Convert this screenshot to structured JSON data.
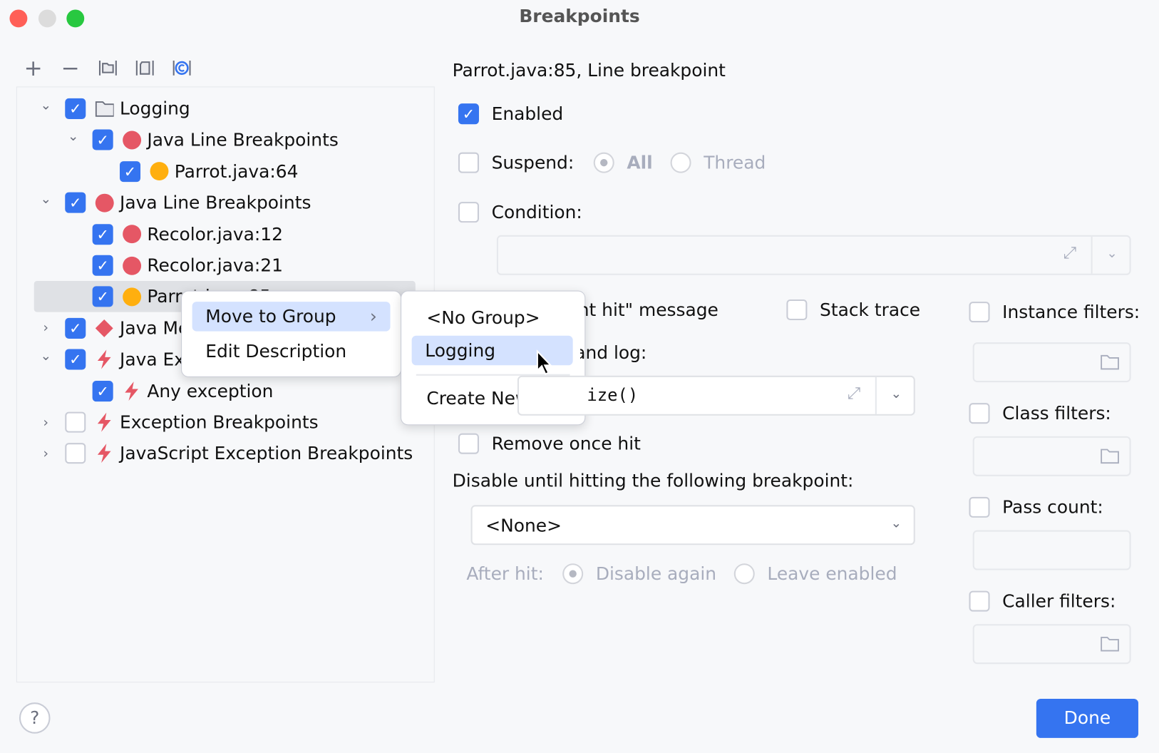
{
  "window": {
    "title": "Breakpoints"
  },
  "colors": {
    "accent": "#3574f0",
    "red_breakpoint": "#e55765",
    "orange_breakpoint": "#ffaf0f",
    "menu_highlight": "#d4e2ff"
  },
  "toolbar": {
    "icons": [
      "plus-icon",
      "minus-icon",
      "folder-group-icon",
      "file-group-icon",
      "class-group-icon"
    ]
  },
  "tree": [
    {
      "label": "Logging",
      "checked": true,
      "expanded": true,
      "icon": "folder-icon"
    },
    {
      "label": "Java Line Breakpoints",
      "checked": true,
      "expanded": true,
      "icon": "red-dot-icon"
    },
    {
      "label": "Parrot.java:64",
      "checked": true,
      "icon": "orange-dot-icon"
    },
    {
      "label": "Java Line Breakpoints",
      "checked": true,
      "expanded": true,
      "icon": "red-dot-icon"
    },
    {
      "label": "Recolor.java:12",
      "checked": true,
      "icon": "red-dot-icon"
    },
    {
      "label": "Recolor.java:21",
      "checked": true,
      "icon": "red-dot-icon"
    },
    {
      "label": "Parrot.java:85",
      "checked": true,
      "icon": "orange-dot-icon",
      "selected": true
    },
    {
      "label": "Java Method Breakpoints",
      "checked": true,
      "expanded": false,
      "icon": "red-diamond-icon"
    },
    {
      "label": "Java Exception Breakpoints",
      "checked": true,
      "expanded": true,
      "icon": "lightning-icon"
    },
    {
      "label": "Any exception",
      "checked": true,
      "icon": "lightning-icon"
    },
    {
      "label": "Exception Breakpoints",
      "checked": false,
      "expanded": false,
      "icon": "lightning-icon"
    },
    {
      "label": "JavaScript Exception Breakpoints",
      "checked": false,
      "expanded": false,
      "icon": "lightning-icon"
    }
  ],
  "context_menu": {
    "items": [
      "Move to Group",
      "Edit Description"
    ]
  },
  "submenu": {
    "items": [
      "<No Group>",
      "Logging",
      "Create New..."
    ]
  },
  "details": {
    "header": "Parrot.java:85, Line breakpoint",
    "enabled": "Enabled",
    "suspend": "Suspend:",
    "suspend_all": "All",
    "suspend_thread": "Thread",
    "condition": "Condition:",
    "log_message": "\"Breakpoint hit\" message",
    "stack_trace": "Stack trace",
    "evaluate_log": "Evaluate and log:",
    "evaluate_value": "ize()",
    "remove_once_hit": "Remove once hit",
    "disable_until": "Disable until hitting the following breakpoint:",
    "disable_select": "<None>",
    "after_hit": "After hit:",
    "disable_again": "Disable again",
    "leave_enabled": "Leave enabled",
    "instance_filters": "Instance filters:",
    "class_filters": "Class filters:",
    "pass_count": "Pass count:",
    "caller_filters": "Caller filters:"
  },
  "footer": {
    "help": "?",
    "done": "Done"
  }
}
